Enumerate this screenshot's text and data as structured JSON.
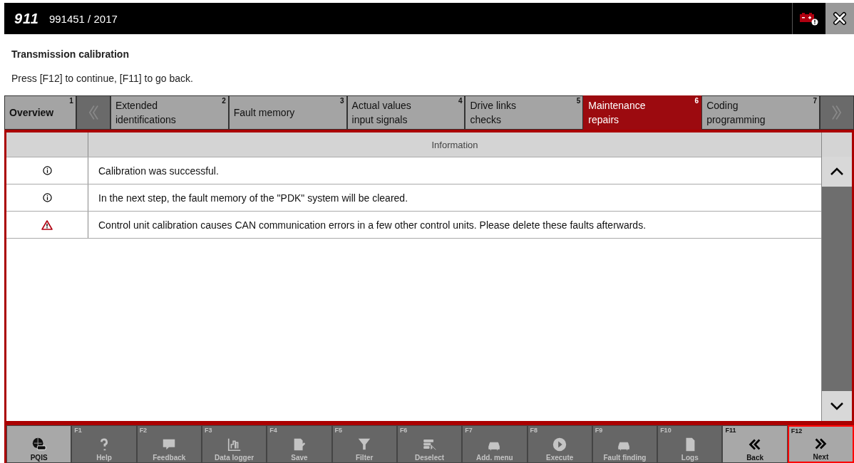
{
  "header": {
    "logo": "911",
    "vehicle": "991451 / 2017"
  },
  "title": "Transmission calibration",
  "instruction": "Press [F12] to continue, [F11] to go back.",
  "tabs": [
    {
      "kind": "tab",
      "number": "1",
      "label": "Overview",
      "selected": false
    },
    {
      "kind": "prev"
    },
    {
      "kind": "tab",
      "number": "2",
      "label": "Extended identifications",
      "selected": false
    },
    {
      "kind": "tab",
      "number": "3",
      "label": "Fault memory",
      "selected": false
    },
    {
      "kind": "tab",
      "number": "4",
      "label": "Actual values input signals",
      "selected": false
    },
    {
      "kind": "tab",
      "number": "5",
      "label": "Drive links checks",
      "selected": false
    },
    {
      "kind": "tab",
      "number": "6",
      "label": "Maintenance repairs",
      "selected": true
    },
    {
      "kind": "tab",
      "number": "7",
      "label": "Coding programming",
      "selected": false
    },
    {
      "kind": "next"
    }
  ],
  "table": {
    "columns": [
      "Information"
    ],
    "rows": [
      {
        "kind": "info",
        "text": "Calibration was successful."
      },
      {
        "kind": "info",
        "text": "In the next step, the fault memory of the \"PDK\" system will be cleared."
      },
      {
        "kind": "warning",
        "text": "Control unit calibration causes CAN communication errors in a few other control units. Please delete these faults afterwards."
      }
    ]
  },
  "toolbar": [
    {
      "kind": "pqis",
      "label": "PQIS",
      "disabled": false,
      "selected": false
    },
    {
      "kind": "help",
      "key": "F1",
      "label": "Help",
      "disabled": true,
      "selected": false
    },
    {
      "kind": "feedback",
      "key": "F2",
      "label": "Feedback",
      "disabled": true,
      "selected": false
    },
    {
      "kind": "chart",
      "key": "F3",
      "label": "Data logger",
      "disabled": true,
      "selected": false
    },
    {
      "kind": "save",
      "key": "F4",
      "label": "Save",
      "disabled": true,
      "selected": false
    },
    {
      "kind": "filter",
      "key": "F5",
      "label": "Filter",
      "disabled": true,
      "selected": false
    },
    {
      "kind": "deselect",
      "key": "F6",
      "label": "Deselect",
      "disabled": true,
      "selected": false
    },
    {
      "kind": "car",
      "key": "F7",
      "label": "Add. menu",
      "disabled": true,
      "selected": false
    },
    {
      "kind": "play",
      "key": "F8",
      "label": "Execute",
      "disabled": true,
      "selected": false
    },
    {
      "kind": "car",
      "key": "F9",
      "label": "Fault finding",
      "disabled": true,
      "selected": false
    },
    {
      "kind": "doc",
      "key": "F10",
      "label": "Logs",
      "disabled": true,
      "selected": false
    },
    {
      "kind": "back",
      "key": "F11",
      "label": "Back",
      "disabled": false,
      "selected": false
    },
    {
      "kind": "forward",
      "key": "F12",
      "label": "Next",
      "disabled": false,
      "selected": true
    }
  ]
}
